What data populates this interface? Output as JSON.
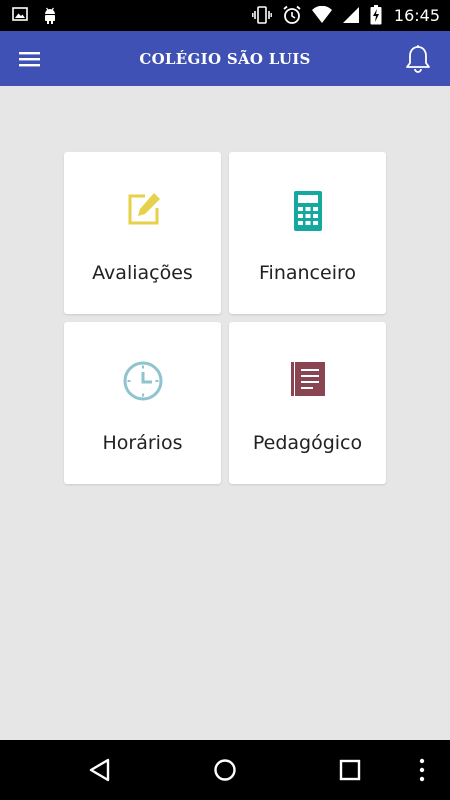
{
  "status_bar": {
    "time": "16:45",
    "icons": [
      "image-icon",
      "android-icon",
      "vibrate-icon",
      "alarm-icon",
      "wifi-icon",
      "signal-icon",
      "battery-charging-icon"
    ]
  },
  "app_bar": {
    "title": "COLÉGIO SÃO LUIS",
    "left_icon": "menu-icon",
    "right_icon": "bell-icon"
  },
  "menu": {
    "items": [
      {
        "label": "Avaliações",
        "icon": "edit-icon",
        "color": "#e6d24a"
      },
      {
        "label": "Financeiro",
        "icon": "calculator-icon",
        "color": "#14a89e"
      },
      {
        "label": "Horários",
        "icon": "clock-icon",
        "color": "#8fc3cf"
      },
      {
        "label": "Pedagógico",
        "icon": "notebook-icon",
        "color": "#8a4552"
      }
    ]
  },
  "nav_bar": {
    "buttons": [
      "back-icon",
      "home-icon",
      "recents-icon",
      "overflow-icon"
    ]
  },
  "colors": {
    "app_bar": "#3f51b5",
    "background": "#e6e6e6"
  }
}
